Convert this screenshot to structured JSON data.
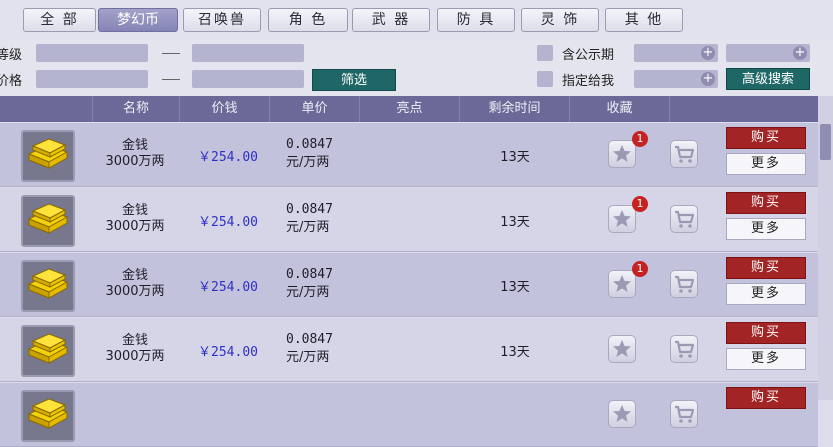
{
  "tabs": [
    {
      "label": "全 部",
      "active": false
    },
    {
      "label": "梦幻币",
      "active": true
    },
    {
      "label": "召唤兽",
      "active": false
    },
    {
      "label": "角 色",
      "active": false
    },
    {
      "label": "武 器",
      "active": false
    },
    {
      "label": "防 具",
      "active": false
    },
    {
      "label": "灵 饰",
      "active": false
    },
    {
      "label": "其 他",
      "active": false
    }
  ],
  "filters": {
    "level_label": "等级",
    "price_label": "价格",
    "filter_button": "筛选",
    "public_period_label": "含公示期",
    "assigned_to_me_label": "指定给我",
    "advanced_search_button": "高级搜索"
  },
  "table": {
    "columns": [
      "名称",
      "价钱",
      "单价",
      "亮点",
      "剩余时间",
      "收藏"
    ],
    "rows": [
      {
        "name_line1": "金钱",
        "name_line2": "3000万两",
        "price": "￥254.00",
        "unit_value": "0.0847",
        "unit_suffix": "元/万两",
        "time": "13天",
        "fav_count": "1",
        "buy": "购买",
        "more": "更多"
      },
      {
        "name_line1": "金钱",
        "name_line2": "3000万两",
        "price": "￥254.00",
        "unit_value": "0.0847",
        "unit_suffix": "元/万两",
        "time": "13天",
        "fav_count": "1",
        "buy": "购买",
        "more": "更多"
      },
      {
        "name_line1": "金钱",
        "name_line2": "3000万两",
        "price": "￥254.00",
        "unit_value": "0.0847",
        "unit_suffix": "元/万两",
        "time": "13天",
        "fav_count": "1",
        "buy": "购买",
        "more": "更多"
      },
      {
        "name_line1": "金钱",
        "name_line2": "3000万两",
        "price": "￥254.00",
        "unit_value": "0.0847",
        "unit_suffix": "元/万两",
        "time": "13天",
        "fav_count": "",
        "buy": "购买",
        "more": "更多"
      },
      {
        "name_line1": "",
        "name_line2": "",
        "price": "",
        "unit_value": "",
        "unit_suffix": "",
        "time": "",
        "fav_count": "",
        "buy": "购买",
        "more": ""
      }
    ]
  },
  "icons": {
    "item_icon": "gold-bars-icon",
    "favorite_icon": "star-icon",
    "cart_icon": "shopping-cart-icon",
    "plus_icon": "plus-icon"
  },
  "colors": {
    "header_bg": "#6a6998",
    "buy_button": "#a32424",
    "price_text": "#3030c8",
    "filter_button": "#1f6767",
    "badge": "#c62222"
  }
}
